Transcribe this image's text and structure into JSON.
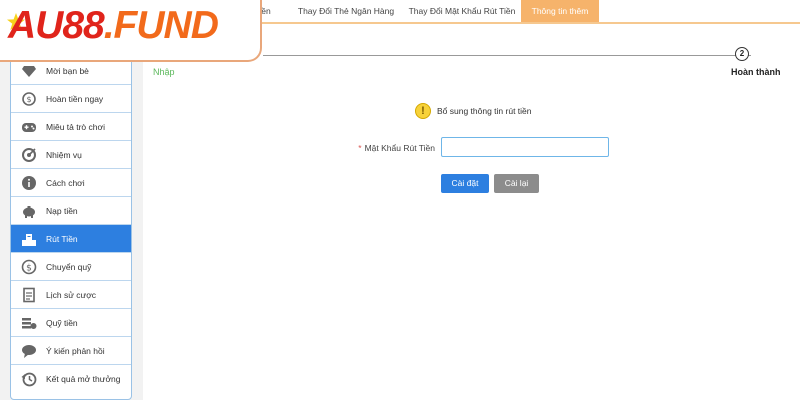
{
  "brand": {
    "logo_text_a": "AU88",
    "logo_text_b": ".FUND"
  },
  "tabs": [
    {
      "label": "iền",
      "active": false
    },
    {
      "label": "Thay Đổi Thẻ Ngân Hàng",
      "active": false
    },
    {
      "label": "Thay Đổi Mật Khẩu Rút Tiền",
      "active": false
    },
    {
      "label": "Thông tin thêm",
      "active": true
    }
  ],
  "sidebar": {
    "items": [
      {
        "label": "Mời bạn bè",
        "icon": "diamond-icon"
      },
      {
        "label": "Hoàn tiền ngay",
        "icon": "coin-refund-icon"
      },
      {
        "label": "Miêu tả trò chơi",
        "icon": "gamepad-icon"
      },
      {
        "label": "Nhiệm vụ",
        "icon": "target-icon"
      },
      {
        "label": "Cách chơi",
        "icon": "info-icon"
      },
      {
        "label": "Nạp tiền",
        "icon": "piggy-bank-icon"
      },
      {
        "label": "Rút Tiền",
        "icon": "atm-icon",
        "active": true
      },
      {
        "label": "Chuyển quỹ",
        "icon": "dollar-circle-icon"
      },
      {
        "label": "Lịch sử cược",
        "icon": "document-icon"
      },
      {
        "label": "Quỹ tiền",
        "icon": "money-stack-icon"
      },
      {
        "label": "Ý kiến phản hồi",
        "icon": "chat-icon"
      },
      {
        "label": "Kết quả mở thưởng",
        "icon": "history-icon"
      }
    ]
  },
  "steps": {
    "current_label": "Nhập",
    "final_number": "2",
    "final_label": "Hoàn thành"
  },
  "form": {
    "notice": "Bổ sung thông tin rút tiền",
    "required_mark": "*",
    "password_label": "Mật Khẩu Rút Tiền",
    "password_value": "",
    "submit_label": "Cài đặt",
    "reset_label": "Cài lại"
  },
  "colors": {
    "accent_blue": "#2d7fe0",
    "tab_active": "#f6b36b",
    "brand_orange": "#f26a1b",
    "step_green": "#5cb85c"
  }
}
